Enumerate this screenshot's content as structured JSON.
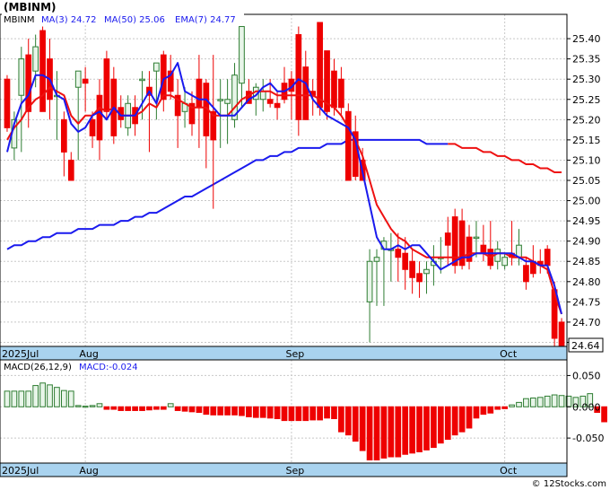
{
  "title": "(MBINM)",
  "legend": {
    "symbol": "MBINM",
    "ma3": "MA(3)  24.72",
    "ma50": "MA(50)  25.06",
    "ema7": "EMA(7)  24.77"
  },
  "macd_legend": {
    "params": "MACD(26,12,9)",
    "value": "MACD:-0.024"
  },
  "last_price_label": "24.64",
  "watermark": "© 12Stocks.com",
  "colors": {
    "up": "#2e7d32",
    "up_fill": "#e8f5e9",
    "down": "#ee0000",
    "ma_blue": "#1a1aee",
    "ema_red": "#ee1111",
    "axis_band": "#a9d3ef"
  },
  "chart_data": [
    {
      "type": "candlestick",
      "title": "(MBINM)",
      "ylim": [
        24.64,
        25.46
      ],
      "y_ticks": [
        "25.40",
        "25.35",
        "25.30",
        "25.25",
        "25.20",
        "25.15",
        "25.10",
        "25.05",
        "25.00",
        "24.95",
        "24.90",
        "24.85",
        "24.80",
        "24.75",
        "24.70",
        "24.65"
      ],
      "x_ticks": [
        {
          "label": "2025Jul",
          "index": 0
        },
        {
          "label": "Aug",
          "index": 11
        },
        {
          "label": "Sep",
          "index": 40
        },
        {
          "label": "Oct",
          "index": 70
        }
      ],
      "ohlc": [
        [
          25.3,
          25.31,
          25.17,
          25.18
        ],
        [
          25.13,
          25.22,
          25.1,
          25.2
        ],
        [
          25.26,
          25.38,
          25.12,
          25.35
        ],
        [
          25.36,
          25.4,
          25.18,
          25.22
        ],
        [
          25.32,
          25.41,
          25.28,
          25.38
        ],
        [
          25.42,
          25.43,
          25.22,
          25.22
        ],
        [
          25.35,
          25.4,
          25.2,
          25.25
        ],
        [
          25.26,
          25.32,
          25.15,
          25.26
        ],
        [
          25.2,
          25.22,
          25.06,
          25.12
        ],
        [
          25.1,
          25.12,
          25.05,
          25.05
        ],
        [
          25.28,
          25.3,
          25.1,
          25.32
        ],
        [
          25.3,
          25.33,
          25.22,
          25.29
        ],
        [
          25.2,
          25.22,
          25.13,
          25.16
        ],
        [
          25.26,
          25.3,
          25.1,
          25.15
        ],
        [
          25.35,
          25.37,
          25.2,
          25.22
        ],
        [
          25.3,
          25.33,
          25.14,
          25.16
        ],
        [
          25.23,
          25.26,
          25.18,
          25.2
        ],
        [
          25.18,
          25.26,
          25.16,
          25.24
        ],
        [
          25.23,
          25.26,
          25.16,
          25.19
        ],
        [
          25.3,
          25.32,
          25.2,
          25.3
        ],
        [
          25.28,
          25.32,
          25.12,
          25.26
        ],
        [
          25.32,
          25.34,
          25.2,
          25.34
        ],
        [
          25.36,
          25.37,
          25.22,
          25.25
        ],
        [
          25.32,
          25.36,
          25.25,
          25.27
        ],
        [
          25.26,
          25.3,
          25.13,
          25.21
        ],
        [
          25.22,
          25.28,
          25.18,
          25.24
        ],
        [
          25.24,
          25.27,
          25.16,
          25.19
        ],
        [
          25.3,
          25.36,
          25.13,
          25.23
        ],
        [
          25.29,
          25.3,
          25.08,
          25.16
        ],
        [
          25.22,
          25.36,
          24.98,
          25.15
        ],
        [
          25.25,
          25.3,
          25.13,
          25.25
        ],
        [
          25.24,
          25.3,
          25.14,
          25.25
        ],
        [
          25.2,
          25.34,
          25.18,
          25.31
        ],
        [
          25.29,
          25.43,
          25.23,
          25.43
        ],
        [
          25.27,
          25.3,
          25.25,
          25.24
        ],
        [
          25.25,
          25.29,
          25.21,
          25.28
        ],
        [
          25.25,
          25.3,
          25.22,
          25.27
        ],
        [
          25.25,
          25.3,
          25.23,
          25.24
        ],
        [
          25.24,
          25.27,
          25.2,
          25.23
        ],
        [
          25.29,
          25.33,
          25.24,
          25.25
        ],
        [
          25.3,
          25.32,
          25.2,
          25.27
        ],
        [
          25.41,
          25.43,
          25.16,
          25.2
        ],
        [
          25.33,
          25.37,
          25.2,
          25.2
        ],
        [
          25.27,
          25.3,
          25.21,
          25.26
        ],
        [
          25.44,
          25.44,
          25.21,
          25.23
        ],
        [
          25.37,
          25.37,
          25.2,
          25.22
        ],
        [
          25.32,
          25.35,
          25.21,
          25.23
        ],
        [
          25.3,
          25.33,
          25.21,
          25.23
        ],
        [
          25.22,
          25.24,
          25.05,
          25.05
        ],
        [
          25.17,
          25.21,
          25.05,
          25.06
        ],
        [
          25.1,
          25.13,
          25.05,
          25.05
        ],
        [
          24.75,
          24.88,
          24.65,
          24.85
        ],
        [
          24.85,
          24.88,
          24.74,
          24.86
        ],
        [
          24.88,
          24.91,
          24.74,
          24.9
        ],
        [
          24.88,
          24.92,
          24.8,
          24.88
        ],
        [
          24.88,
          24.92,
          24.8,
          24.86
        ],
        [
          24.87,
          24.91,
          24.78,
          24.83
        ],
        [
          24.85,
          24.88,
          24.77,
          24.81
        ],
        [
          24.82,
          24.85,
          24.76,
          24.8
        ],
        [
          24.82,
          24.85,
          24.77,
          24.83
        ],
        [
          24.84,
          24.89,
          24.79,
          24.85
        ],
        [
          24.86,
          24.91,
          24.82,
          24.86
        ],
        [
          24.92,
          24.96,
          24.84,
          24.89
        ],
        [
          24.96,
          24.98,
          24.82,
          24.84
        ],
        [
          24.95,
          24.98,
          24.83,
          24.84
        ],
        [
          24.91,
          24.94,
          24.83,
          24.85
        ],
        [
          24.91,
          24.95,
          24.86,
          24.91
        ],
        [
          24.89,
          24.94,
          24.85,
          24.87
        ],
        [
          24.88,
          24.95,
          24.83,
          24.84
        ],
        [
          24.85,
          24.9,
          24.83,
          24.88
        ],
        [
          24.84,
          24.87,
          24.83,
          24.86
        ],
        [
          24.87,
          24.95,
          24.84,
          24.86
        ],
        [
          24.86,
          24.93,
          24.84,
          24.89
        ],
        [
          24.84,
          24.86,
          24.78,
          24.8
        ],
        [
          24.85,
          24.89,
          24.81,
          24.82
        ],
        [
          24.85,
          24.88,
          24.82,
          24.84
        ],
        [
          24.88,
          24.89,
          24.82,
          24.84
        ],
        [
          24.78,
          24.8,
          24.63,
          24.66
        ],
        [
          24.7,
          24.71,
          24.64,
          24.64
        ]
      ],
      "ma3": [
        25.12,
        25.19,
        25.24,
        25.26,
        25.31,
        25.31,
        25.3,
        25.26,
        25.25,
        25.19,
        25.17,
        25.18,
        25.21,
        25.22,
        25.2,
        25.23,
        25.21,
        25.21,
        25.21,
        25.24,
        25.27,
        25.24,
        25.3,
        25.31,
        25.34,
        25.27,
        25.26,
        25.25,
        25.25,
        25.23,
        25.21,
        25.21,
        25.21,
        25.23,
        25.25,
        25.26,
        25.28,
        25.29,
        25.27,
        25.27,
        25.28,
        25.3,
        25.29,
        25.25,
        25.23,
        25.21,
        25.2,
        25.19,
        25.18,
        25.15,
        25.07,
        24.99,
        24.91,
        24.88,
        24.88,
        24.89,
        24.88,
        24.89,
        24.89,
        24.87,
        24.85,
        24.83,
        24.84,
        24.85,
        24.86,
        24.86,
        24.87,
        24.87,
        24.87,
        24.87,
        24.87,
        24.87,
        24.86,
        24.85,
        24.85,
        24.84,
        24.84,
        24.79,
        24.72
      ],
      "ema7": [
        25.15,
        25.18,
        25.2,
        25.23,
        25.25,
        25.26,
        25.28,
        25.27,
        25.26,
        25.21,
        25.19,
        25.21,
        25.21,
        25.23,
        25.22,
        25.23,
        25.21,
        25.21,
        25.21,
        25.22,
        25.24,
        25.23,
        25.26,
        25.26,
        25.25,
        25.24,
        25.23,
        25.23,
        25.23,
        25.21,
        25.21,
        25.21,
        25.23,
        25.25,
        25.26,
        25.27,
        25.27,
        25.27,
        25.26,
        25.26,
        25.26,
        25.26,
        25.26,
        25.26,
        25.25,
        25.24,
        25.23,
        25.21,
        25.18,
        25.15,
        25.11,
        25.05,
        24.99,
        24.96,
        24.93,
        24.91,
        24.9,
        24.88,
        24.87,
        24.86,
        24.86,
        24.86,
        24.86,
        24.86,
        24.86,
        24.87,
        24.87,
        24.87,
        24.86,
        24.87,
        24.87,
        24.86,
        24.86,
        24.86,
        24.85,
        24.84,
        24.83,
        24.77,
        24.72
      ],
      "ma50": [
        24.88,
        24.89,
        24.89,
        24.9,
        24.9,
        24.91,
        24.91,
        24.92,
        24.92,
        24.92,
        24.93,
        24.93,
        24.93,
        24.94,
        24.94,
        24.94,
        24.95,
        24.95,
        24.96,
        24.96,
        24.97,
        24.97,
        24.98,
        24.99,
        25.0,
        25.01,
        25.01,
        25.02,
        25.03,
        25.04,
        25.05,
        25.06,
        25.07,
        25.08,
        25.09,
        25.1,
        25.1,
        25.11,
        25.11,
        25.12,
        25.12,
        25.13,
        25.13,
        25.13,
        25.13,
        25.14,
        25.14,
        25.14,
        25.15,
        25.15,
        25.15,
        25.15,
        25.15,
        25.15,
        25.15,
        25.15,
        25.15,
        25.15,
        25.15,
        25.14,
        25.14,
        25.14,
        25.14,
        25.14,
        25.13,
        25.13,
        25.13,
        25.12,
        25.12,
        25.11,
        25.11,
        25.1,
        25.1,
        25.09,
        25.09,
        25.08,
        25.08,
        25.07,
        25.07
      ]
    },
    {
      "type": "bar",
      "title": "MACD(26,12,9)",
      "ylim": [
        -0.09,
        0.075
      ],
      "y_ticks": [
        "0.050",
        "0.000",
        "-0.050"
      ],
      "x_ticks": [
        {
          "label": "2025Jul",
          "index": 0
        },
        {
          "label": "Aug",
          "index": 11
        },
        {
          "label": "Sep",
          "index": 40
        },
        {
          "label": "Oct",
          "index": 70
        }
      ],
      "values": [
        0.025,
        0.025,
        0.025,
        0.025,
        0.034,
        0.038,
        0.035,
        0.031,
        0.026,
        0.025,
        0.002,
        0.001,
        0.002,
        0.005,
        -0.004,
        -0.004,
        -0.006,
        -0.006,
        -0.006,
        -0.006,
        -0.005,
        -0.004,
        -0.004,
        0.005,
        -0.006,
        -0.007,
        -0.008,
        -0.009,
        -0.012,
        -0.013,
        -0.013,
        -0.013,
        -0.013,
        -0.014,
        -0.016,
        -0.017,
        -0.017,
        -0.018,
        -0.019,
        -0.022,
        -0.022,
        -0.022,
        -0.022,
        -0.021,
        -0.021,
        -0.018,
        -0.019,
        -0.04,
        -0.045,
        -0.055,
        -0.07,
        -0.085,
        -0.085,
        -0.082,
        -0.08,
        -0.08,
        -0.076,
        -0.074,
        -0.072,
        -0.069,
        -0.065,
        -0.058,
        -0.052,
        -0.045,
        -0.04,
        -0.034,
        -0.018,
        -0.012,
        -0.01,
        -0.004,
        -0.003,
        0.003,
        0.007,
        0.013,
        0.014,
        0.015,
        0.017,
        0.019,
        0.018,
        0.017,
        0.015,
        0.017,
        0.021,
        -0.009,
        -0.024
      ]
    }
  ]
}
